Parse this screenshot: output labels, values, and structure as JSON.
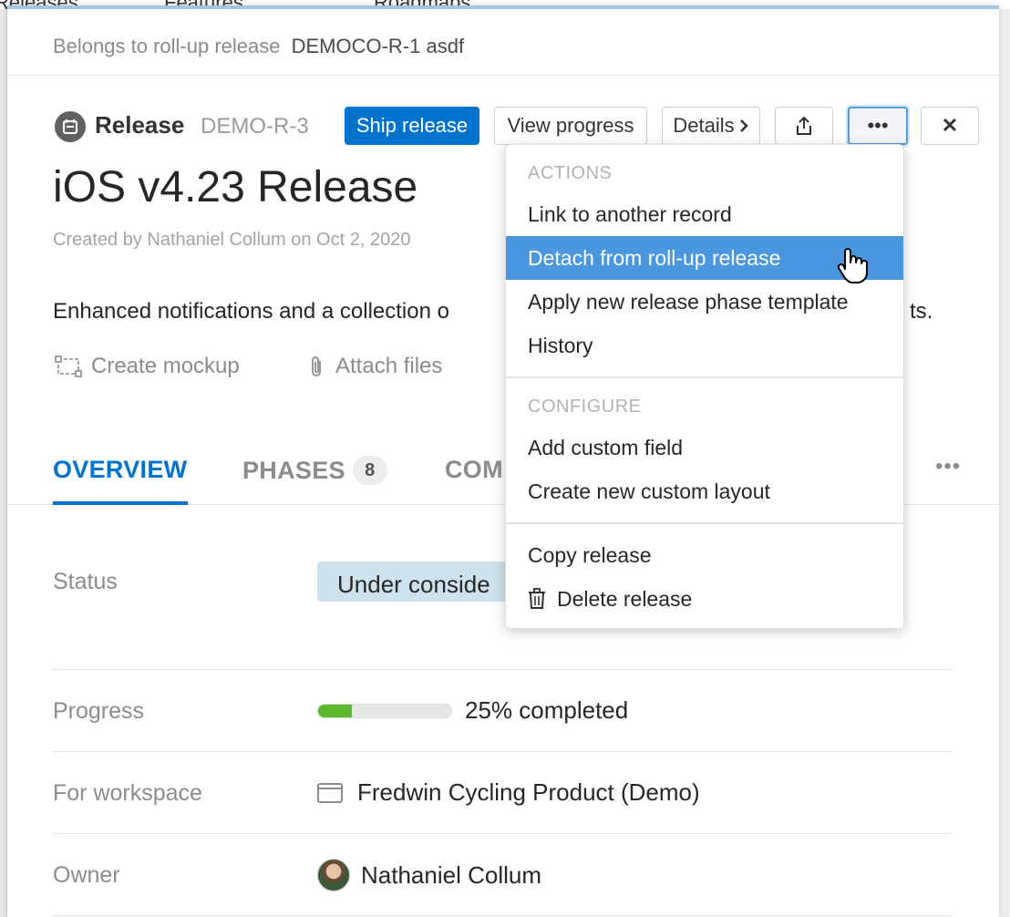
{
  "background_nav": [
    "Releases",
    "Features",
    "Roadmaps"
  ],
  "rollup": {
    "prefix": "Belongs to roll-up release",
    "link": "DEMOCO-R-1 asdf"
  },
  "record": {
    "type": "Release",
    "id": "DEMO-R-3"
  },
  "toolbar": {
    "ship": "Ship release",
    "view_progress": "View progress",
    "details": "Details",
    "more": "•••",
    "close": "✕"
  },
  "title": "iOS v4.23 Release",
  "created": "Created by Nathaniel Collum on Oct 2, 2020",
  "description": {
    "start": "Enhanced notifications and a collection o",
    "end": "ts."
  },
  "attachments": {
    "mockup": "Create mockup",
    "files": "Attach files"
  },
  "tabs": {
    "overview": "OVERVIEW",
    "phases": "PHASES",
    "phases_count": "8",
    "comments": "COM",
    "more": "•••"
  },
  "fields": {
    "status": {
      "label": "Status",
      "value": "Under conside"
    },
    "progress": {
      "label": "Progress",
      "value": "25% completed",
      "percent": 25
    },
    "workspace": {
      "label": "For workspace",
      "value": "Fredwin Cycling Product (Demo)"
    },
    "owner": {
      "label": "Owner",
      "value": "Nathaniel Collum"
    }
  },
  "menu": {
    "actions_heading": "ACTIONS",
    "link": "Link to another record",
    "detach": "Detach from roll-up release",
    "apply_template": "Apply new release phase template",
    "history": "History",
    "configure_heading": "CONFIGURE",
    "add_field": "Add custom field",
    "new_layout": "Create new custom layout",
    "copy": "Copy release",
    "delete": "Delete release"
  },
  "colors": {
    "primary": "#0073cf",
    "highlight": "#4a97e0",
    "progress": "#5cb82a",
    "status_bg": "#cde2ec"
  }
}
